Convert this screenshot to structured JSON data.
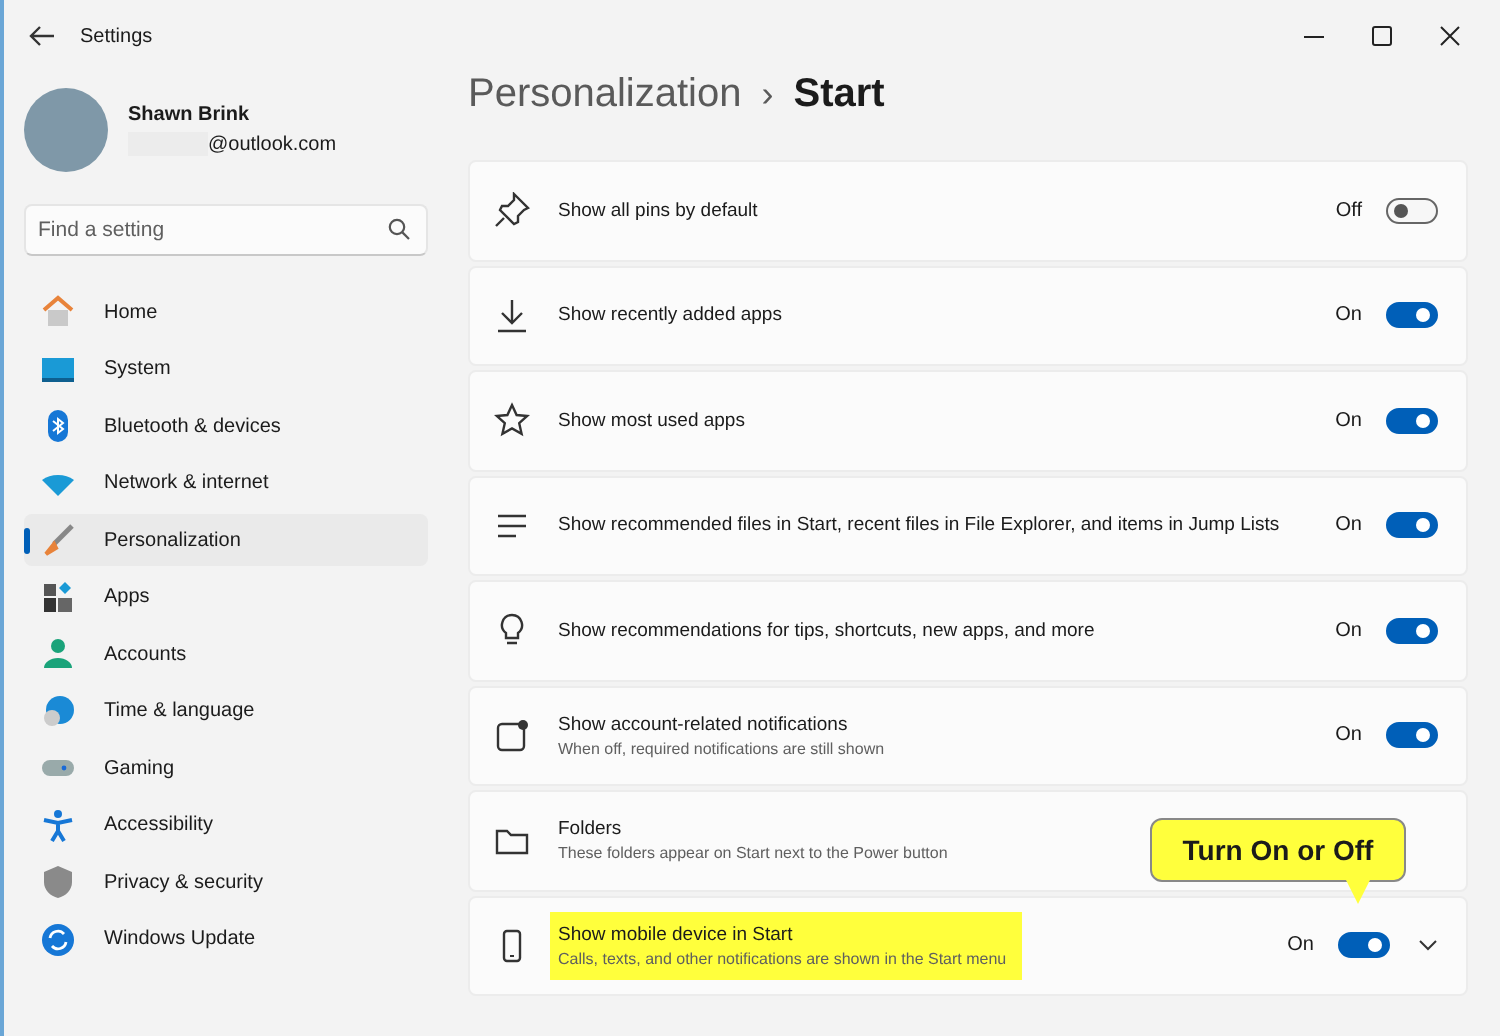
{
  "window": {
    "title": "Settings"
  },
  "account": {
    "name": "Shawn Brink",
    "email": "@outlook.com"
  },
  "search": {
    "placeholder": "Find a setting"
  },
  "sidebar": {
    "items": [
      {
        "label": "Home",
        "selected": false
      },
      {
        "label": "System",
        "selected": false
      },
      {
        "label": "Bluetooth & devices",
        "selected": false
      },
      {
        "label": "Network & internet",
        "selected": false
      },
      {
        "label": "Personalization",
        "selected": true
      },
      {
        "label": "Apps",
        "selected": false
      },
      {
        "label": "Accounts",
        "selected": false
      },
      {
        "label": "Time & language",
        "selected": false
      },
      {
        "label": "Gaming",
        "selected": false
      },
      {
        "label": "Accessibility",
        "selected": false
      },
      {
        "label": "Privacy & security",
        "selected": false
      },
      {
        "label": "Windows Update",
        "selected": false
      }
    ]
  },
  "breadcrumb": {
    "parent": "Personalization",
    "separator": "›",
    "current": "Start"
  },
  "settings": [
    {
      "kind": "toggle",
      "title": "Show all pins by default",
      "on": false,
      "state_text": "Off"
    },
    {
      "kind": "toggle",
      "title": "Show recently added apps",
      "on": true,
      "state_text": "On"
    },
    {
      "kind": "toggle",
      "title": "Show most used apps",
      "on": true,
      "state_text": "On"
    },
    {
      "kind": "toggle",
      "title": "Show recommended files in Start, recent files in File Explorer, and items in Jump Lists",
      "on": true,
      "state_text": "On"
    },
    {
      "kind": "toggle",
      "title": "Show recommendations for tips, shortcuts, new apps, and more",
      "on": true,
      "state_text": "On"
    },
    {
      "kind": "toggle",
      "title": "Show account-related notifications",
      "description": "When off, required notifications are still shown",
      "on": true,
      "state_text": "On"
    },
    {
      "kind": "link",
      "title": "Folders",
      "description": "These folders appear on Start next to the Power button"
    },
    {
      "kind": "toggle",
      "title": "Show mobile device in Start",
      "description": "Calls, texts, and other notifications are shown in the Start menu",
      "on": true,
      "state_text": "On",
      "highlighted": true,
      "expanded": false
    }
  ],
  "callout": {
    "text": "Turn On or Off"
  }
}
